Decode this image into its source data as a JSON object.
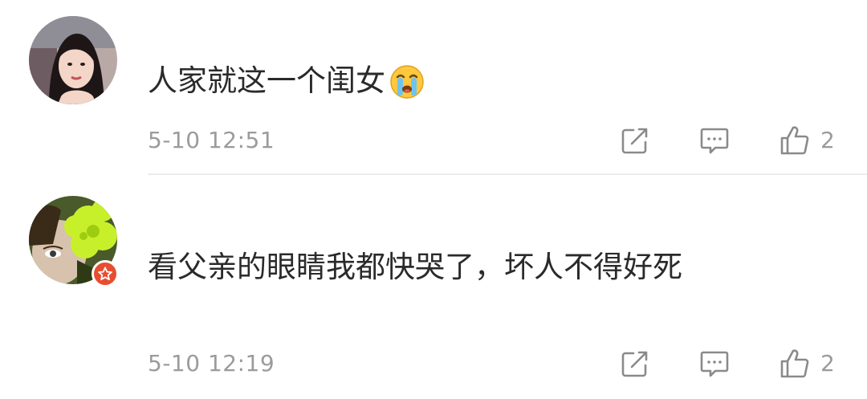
{
  "comments": [
    {
      "text": "人家就这一个闺女",
      "emoji": "loudly-crying-face",
      "time": "5-10 12:51",
      "likes": "2"
    },
    {
      "text": "看父亲的眼睛我都快哭了，坏人不得好死",
      "time": "5-10 12:19",
      "likes": "2"
    }
  ],
  "colors": {
    "text": "#2a2a2a",
    "meta": "#9b9b9b",
    "divider": "#ececec",
    "badge": "#e94d2f"
  }
}
